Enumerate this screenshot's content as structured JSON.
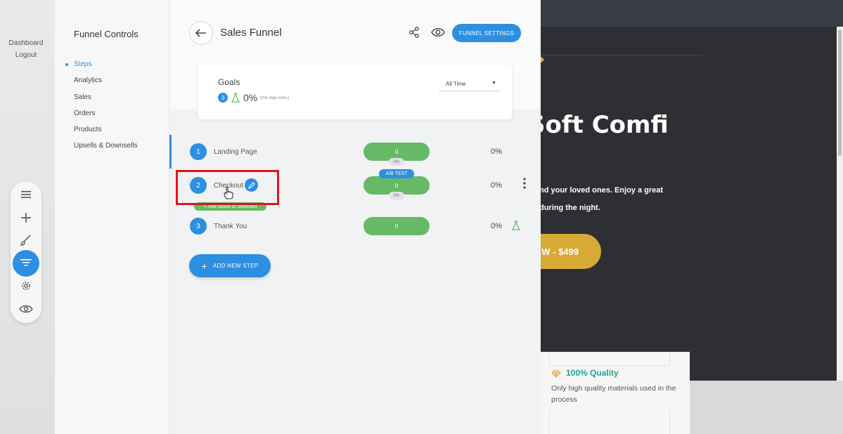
{
  "wp": {
    "dashboard": "Dashboard",
    "logout": "Logout"
  },
  "sidebar": {
    "title": "Funnel Controls",
    "items": [
      {
        "label": "Steps",
        "active": true
      },
      {
        "label": "Analytics"
      },
      {
        "label": "Sales"
      },
      {
        "label": "Orders"
      },
      {
        "label": "Products"
      },
      {
        "label": "Upsells & Downsells"
      }
    ]
  },
  "header": {
    "title": "Sales Funnel",
    "settings_label": "FUNNEL SETTINGS"
  },
  "goals": {
    "label": "Goals",
    "badge": "3",
    "percent": "0%",
    "sub": "(0% step conv.)",
    "range": "All Time"
  },
  "steps": [
    {
      "num": "1",
      "name": "Landing Page",
      "value": "0",
      "sub": "0%",
      "pct": "0%"
    },
    {
      "num": "2",
      "name": "Checkout",
      "value": "0",
      "sub": "0%",
      "pct": "0%",
      "ab_label": "A/B TEST"
    },
    {
      "num": "3",
      "name": "Thank You",
      "value": "0",
      "pct": "0%"
    }
  ],
  "add_upsell": "+ Add upsell or downsell",
  "add_step_label": "ADD NEW STEP",
  "preview": {
    "hero_title": "Soft Comfi",
    "line1": "nd your loved ones. Enjoy a great",
    "line2": "during the night.",
    "cta": "W - $499",
    "quality_title": "100% Quality",
    "quality_text": "Only high quality materials used in the process"
  },
  "colors": {
    "accent": "#2d8fe0",
    "green": "#66b966",
    "highlight": "#e3141a",
    "gold": "#d7a935"
  }
}
